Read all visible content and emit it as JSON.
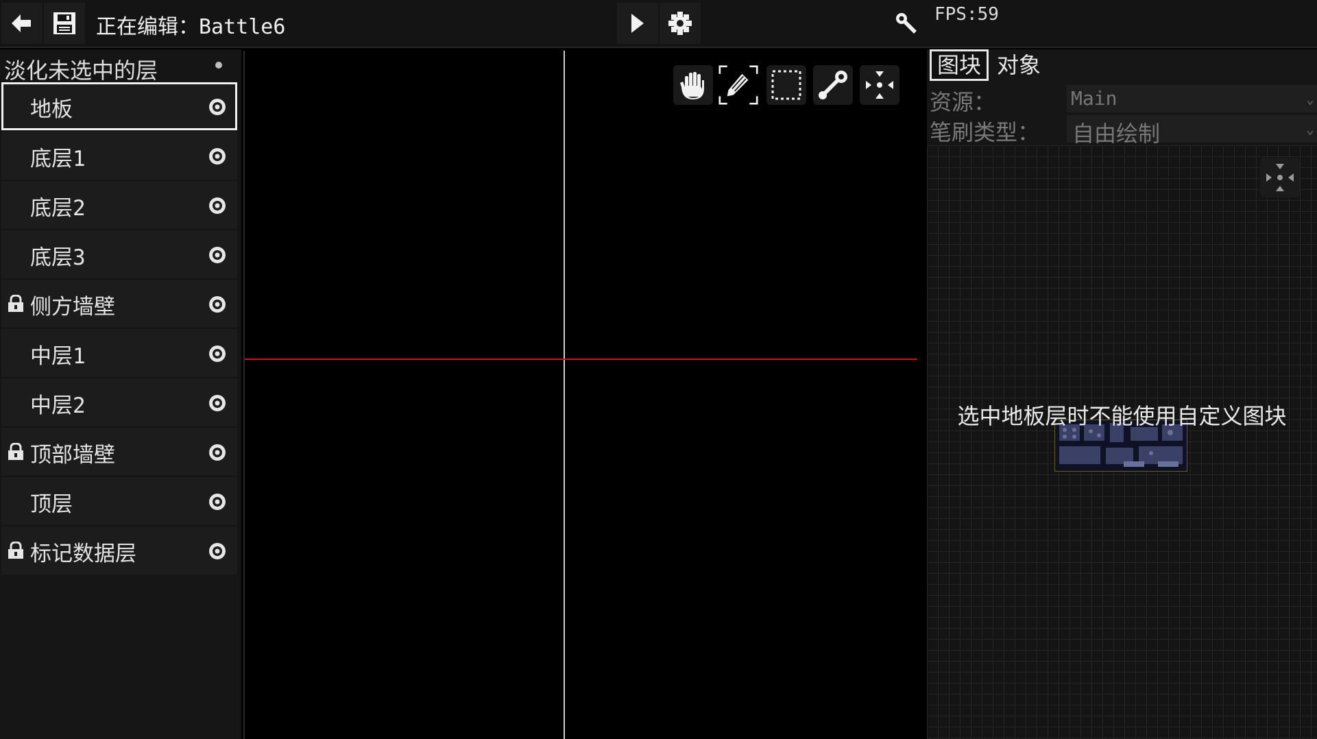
{
  "topbar": {
    "back_icon": "arrow-left-icon",
    "save_icon": "floppy-disk-icon",
    "title_prefix": "正在编辑：",
    "map_name": "Battle6",
    "play_icon": "play-icon",
    "settings_icon": "gear-icon",
    "tools_icon": "wrench-icon",
    "fps": "FPS:59"
  },
  "layers": {
    "fade_unselected_label": "淡化未选中的层",
    "items": [
      {
        "name": "地板",
        "locked": false,
        "selected": true
      },
      {
        "name": "底层1",
        "locked": false,
        "selected": false
      },
      {
        "name": "底层2",
        "locked": false,
        "selected": false
      },
      {
        "name": "底层3",
        "locked": false,
        "selected": false
      },
      {
        "name": "侧方墙壁",
        "locked": true,
        "selected": false
      },
      {
        "name": "中层1",
        "locked": false,
        "selected": false
      },
      {
        "name": "中层2",
        "locked": false,
        "selected": false
      },
      {
        "name": "顶部墙壁",
        "locked": true,
        "selected": false
      },
      {
        "name": "顶层",
        "locked": false,
        "selected": false
      },
      {
        "name": "标记数据层",
        "locked": true,
        "selected": false
      }
    ]
  },
  "canvas_tools": [
    {
      "icon": "hand-icon",
      "active": false
    },
    {
      "icon": "pencil-icon",
      "active": true
    },
    {
      "icon": "marquee-select-icon",
      "active": false
    },
    {
      "icon": "wrench-icon",
      "active": false
    },
    {
      "icon": "fit-view-icon",
      "active": false
    }
  ],
  "right_panel": {
    "tabs": [
      "图块",
      "对象"
    ],
    "active_tab": "图块",
    "source_label": "资源：",
    "source_value": "Main",
    "brush_label": "笔刷类型：",
    "brush_value": "自由绘制",
    "notice": "选中地板层时不能使用自定义图块"
  },
  "colors": {
    "background": "#000000",
    "panel": "#151515",
    "axis_horizontal": "#c81414",
    "axis_vertical": "#cfcfcf"
  }
}
